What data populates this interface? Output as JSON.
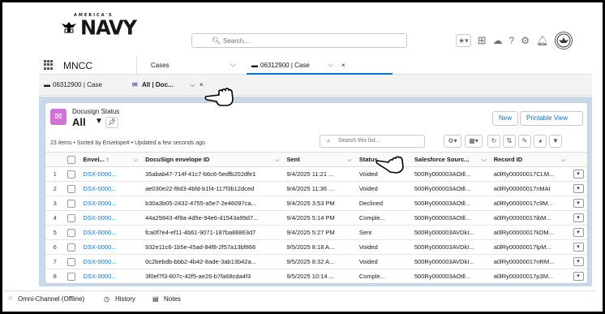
{
  "header": {
    "logo_small": "AMERICA'S",
    "logo_big": "NAVY",
    "search_placeholder": "Search...",
    "icons": [
      "star-icon",
      "chevron-down-icon",
      "add-icon",
      "cloud-icon",
      "help-icon",
      "gear-icon",
      "bell-icon",
      "avatar"
    ]
  },
  "nav": {
    "app_name": "MNCC",
    "tabs": [
      {
        "label": "Cases"
      },
      {
        "label": "06312900 | Case"
      }
    ]
  },
  "subtabs": [
    {
      "label": "06312900 | Case"
    },
    {
      "label": "All | Doc..."
    }
  ],
  "list": {
    "object_label": "Docusign Status",
    "view_name": "All",
    "meta": "23 items • Sorted by Envelope# • Updated a few seconds ago",
    "new_label": "New",
    "printable_label": "Printable View",
    "search_placeholder": "Search this list...",
    "columns": [
      "Envel...",
      "DocuSign envelope ID",
      "Sent",
      "Status",
      "Salesforce Sourc...",
      "Record ID"
    ],
    "rows": [
      {
        "num": "1",
        "env": "DSX-0000...",
        "docid": "35abab47-714f-41c7-b6c6-5edfb202dfe1",
        "sent": "9/4/2025 11:21 ...",
        "status": "Voided",
        "source": "500Ry000003AOtll...",
        "record": "a0lRy00000017CLM..."
      },
      {
        "num": "2",
        "env": "DSX-0000...",
        "docid": "ae030e22-f8d3-4bfd-b1f4-117f3b12dced",
        "sent": "9/4/2025 11:36 ...",
        "status": "Voided",
        "source": "500Ry000003AOtll...",
        "record": "a0lRy00000017nMAI"
      },
      {
        "num": "3",
        "env": "DSX-0000...",
        "docid": "b30a3b05-2432-4755-a5e7-2e46097ca...",
        "sent": "9/4/2025 3:53 PM",
        "status": "Declined",
        "source": "500Ry000003AOtll...",
        "record": "a0lRy00000017c9M..."
      },
      {
        "num": "4",
        "env": "DSX-0000...",
        "docid": "44a29843-4f9a-4d5e-94e6-d1543a99d7...",
        "sent": "9/4/2025 5:14 PM",
        "status": "Comple...",
        "source": "500Ry000003AOtll...",
        "record": "a0lRy00000017ibM..."
      },
      {
        "num": "5",
        "env": "DSX-0000...",
        "docid": "fca0f7e4-ef11-4b61-9071-187ba88863d7",
        "sent": "9/4/2025 5:27 PM",
        "status": "Sent",
        "source": "500Ry000003AVDkI...",
        "record": "a0lRy00000017kDM..."
      },
      {
        "num": "6",
        "env": "DSX-0000...",
        "docid": "932e11c6-1b5e-45ad-84f8-2f57a13bf866",
        "sent": "9/5/2025 8:18 A...",
        "status": "Voided",
        "source": "500Ry000003AVDkI...",
        "record": "a0lRy00000017lpM..."
      },
      {
        "num": "7",
        "env": "DSX-0000...",
        "docid": "0c2bebdb-bbb2-4b42-8ade-3ab13b42a...",
        "sent": "9/5/2025 8:32 A...",
        "status": "Voided",
        "source": "500Ry000003AVDkI...",
        "record": "a0lRy00000017nRM..."
      },
      {
        "num": "8",
        "env": "DSX-0000...",
        "docid": "3f0ef7f3-607c-42f5-ae26-b7fa68cda4f3",
        "sent": "9/5/2025 10:14 ...",
        "status": "Comple...",
        "source": "500Ry000003AOtll...",
        "record": "a0lRy00000017p3M..."
      }
    ]
  },
  "utility": {
    "omni": "Omni-Channel (Offline)",
    "history": "History",
    "notes": "Notes"
  },
  "colors": {
    "accent": "#0176d3",
    "object_icon": "#d372d6",
    "workspace_bg": "#c8d9ec",
    "offline": "#c23934"
  }
}
